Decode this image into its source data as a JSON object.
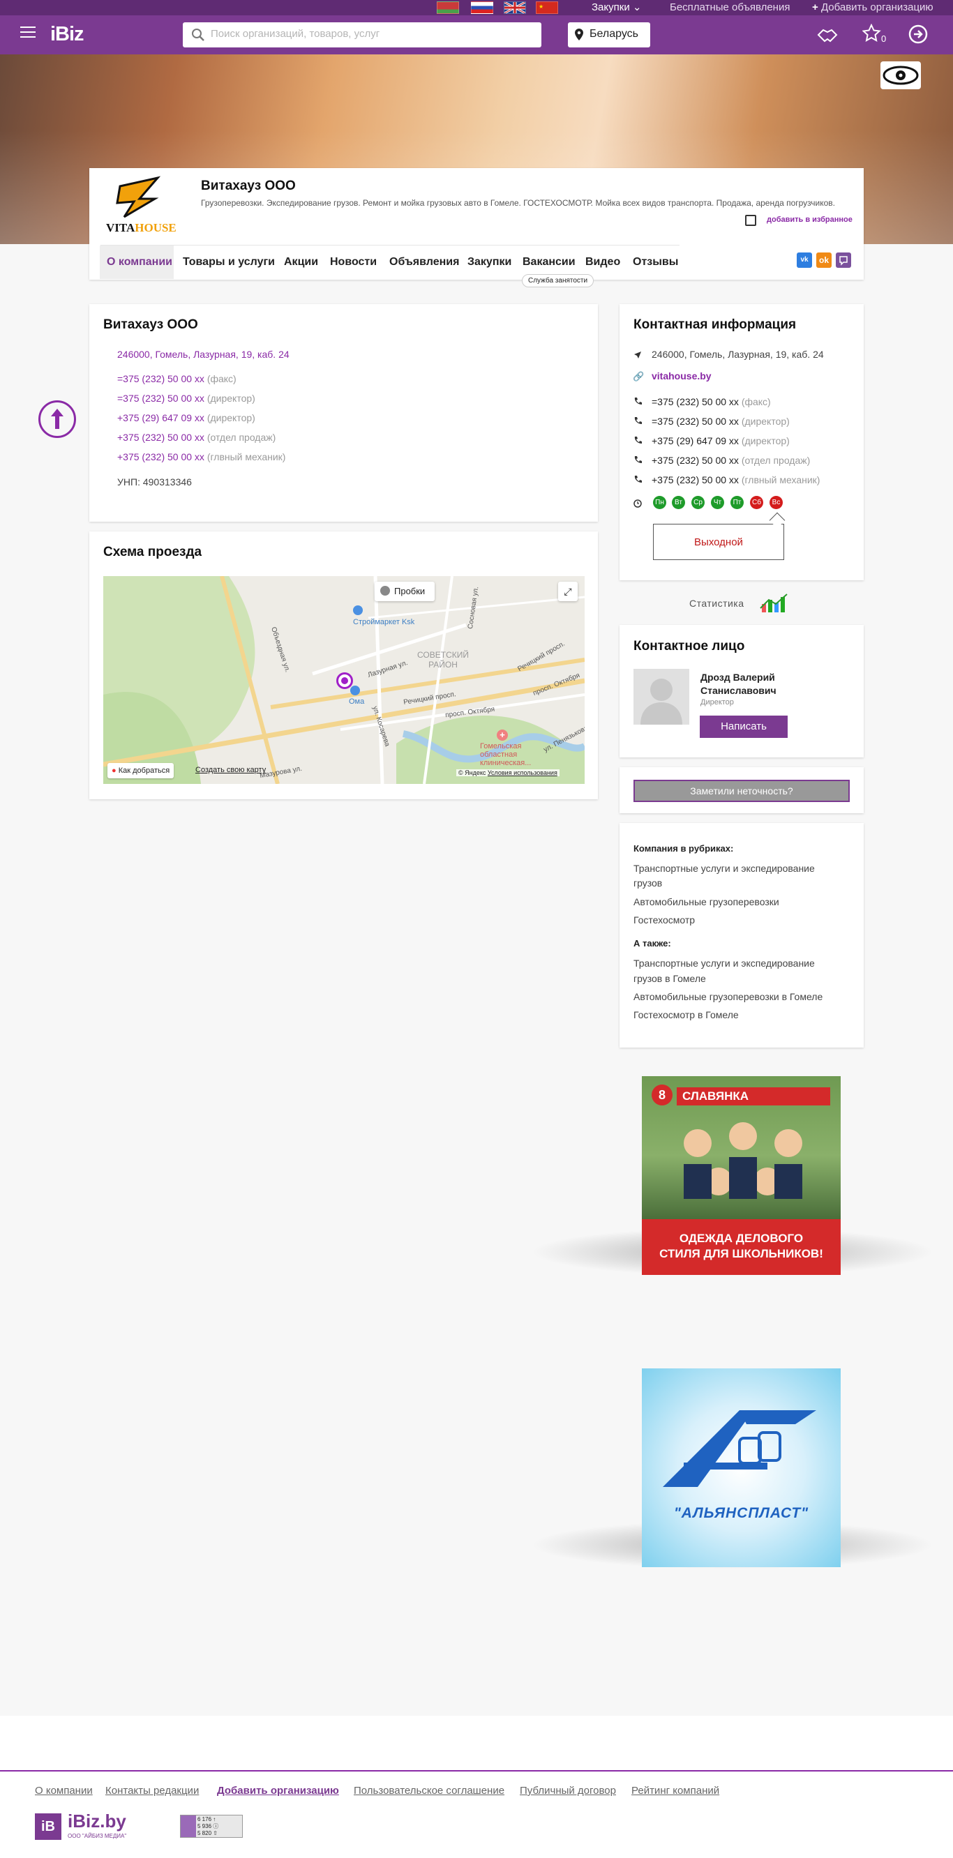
{
  "topbar": {
    "purchases_label": "Закупки",
    "free_ads_label": "Бесплатные объявления",
    "add_org_label": "Добавить организацию"
  },
  "header": {
    "logo": "iBiz",
    "search_placeholder": "Поиск организаций, товаров, услуг",
    "region": "Беларусь",
    "favorites_count": "0"
  },
  "company": {
    "name": "Витахауз ООО",
    "logo_text_vita": "VITA",
    "logo_text_house": "HOUSE",
    "description": "Грузоперевозки. Экспедирование грузов. Ремонт и мойка грузовых авто в Гомеле. ГОСТЕХОСМОТР. Мойка всех видов транспорта. Продажа, аренда погрузчиков.",
    "favorite_label": "добавить в избранное"
  },
  "tabs": [
    {
      "label": "О компании"
    },
    {
      "label": "Товары и услуги"
    },
    {
      "label": "Акции"
    },
    {
      "label": "Новости"
    },
    {
      "label": "Объявления"
    },
    {
      "label": "Закупки"
    },
    {
      "label": "Вакансии"
    },
    {
      "label": "Видео"
    },
    {
      "label": "Отзывы"
    }
  ],
  "tooltip": "Служба занятости",
  "about": {
    "title": "Витахауз ООО",
    "address": "246000, Гомель, Лазурная, 19, каб. 24",
    "phones": [
      {
        "number": "=375 (232) 50 00 xx",
        "note": "(факс)"
      },
      {
        "number": "=375 (232) 50 00 xx",
        "note": "(директор)"
      },
      {
        "number": "+375 (29) 647 09 xx",
        "note": "(директор)"
      },
      {
        "number": "+375 (232) 50 00 xx",
        "note": "(отдел продаж)"
      },
      {
        "number": "+375 (232) 50 00 xx",
        "note": "(глвный механик)"
      }
    ],
    "unp": "УНП: 490313346"
  },
  "map": {
    "title": "Схема проезда",
    "traffic": "Пробки",
    "route": "Как добраться",
    "create": "Создать свою карту",
    "copyright": "© Яндекс",
    "terms": "Условия использования",
    "labels": {
      "store": "Строймаркет Ksk",
      "district1": "СОВЕТСКИЙ",
      "district2": "РАЙОН",
      "oma": "Ома",
      "hospital1": "Гомельская",
      "hospital2": "областная",
      "hospital3": "клиническая...",
      "street1": "Речицкий просп.",
      "street2": "Речицкий просп.",
      "street3": "просп. Октября",
      "street4": "просп. Октября",
      "street5": "Лазурная ул.",
      "street6": "Объездная ул.",
      "street7": "Сосновая ул.",
      "street8": "ул. Косарева",
      "street9": "ул. Пенязькова",
      "street10": "Мазурова ул."
    }
  },
  "contacts": {
    "title": "Контактная информация",
    "address": "246000, Гомель, Лазурная, 19, каб. 24",
    "site": "vitahouse.by",
    "phones": [
      {
        "number": "=375 (232) 50 00 xx",
        "note": "(факс)"
      },
      {
        "number": "=375 (232) 50 00 xx",
        "note": "(директор)"
      },
      {
        "number": "+375 (29) 647 09 xx",
        "note": "(директор)"
      },
      {
        "number": "+375 (232) 50 00 xx",
        "note": "(отдел продаж)"
      },
      {
        "number": "+375 (232) 50 00 xx",
        "note": "(глвный механик)"
      }
    ],
    "days": [
      {
        "label": "Пн",
        "color": "#1e9b2a"
      },
      {
        "label": "Вт",
        "color": "#1e9b2a"
      },
      {
        "label": "Ср",
        "color": "#1e9b2a"
      },
      {
        "label": "Чт",
        "color": "#1e9b2a"
      },
      {
        "label": "Пт",
        "color": "#1e9b2a"
      },
      {
        "label": "Сб",
        "color": "#d41c1c"
      },
      {
        "label": "Вс",
        "color": "#d41c1c"
      }
    ],
    "day_off": "Выходной"
  },
  "stats_label": "Статистика",
  "person": {
    "title": "Контактное лицо",
    "name1": "Дрозд Валерий",
    "name2": "Станиславович",
    "position": "Директор",
    "write": "Написать"
  },
  "inaccuracy": "Заметили неточность?",
  "rubrics": {
    "heading": "Компания в рубриках:",
    "items": [
      "Транспортные услуги и экспедирование",
      "грузов",
      "Автомобильные грузоперевозки",
      "Гостехосмотр"
    ],
    "also_heading": "А также:",
    "also": [
      "Транспортные услуги и экспедирование",
      "грузов в Гомеле",
      "Автомобильные грузоперевозки в Гомеле",
      "Гостехосмотр в Гомеле"
    ]
  },
  "ads": {
    "ad1_brand": "СЛАВЯНКА",
    "ad1_badge": "8",
    "ad1_line1": "ОДЕЖДА ДЕЛОВОГО",
    "ad1_line2": "СТИЛЯ ДЛЯ ШКОЛЬНИКОВ!",
    "ad2_brand": "\"АЛЬЯНСПЛАСТ\""
  },
  "footer": {
    "links": [
      "О компании",
      "Контакты редакции",
      "Добавить организацию",
      "Пользовательское соглашение",
      "Публичный договор",
      "Рейтинг компаний"
    ],
    "logo_box": "iB",
    "logo_text": "iBiz.by",
    "logo_sub": "ООО \"АЙБИЗ МЕДИА\"",
    "counter": [
      "6 176 ↑",
      "5 936 ⓘ",
      "5 820 ⇧"
    ]
  },
  "colors": {
    "brand": "#7b3a91",
    "accent_purple": "#8a2aa6"
  }
}
